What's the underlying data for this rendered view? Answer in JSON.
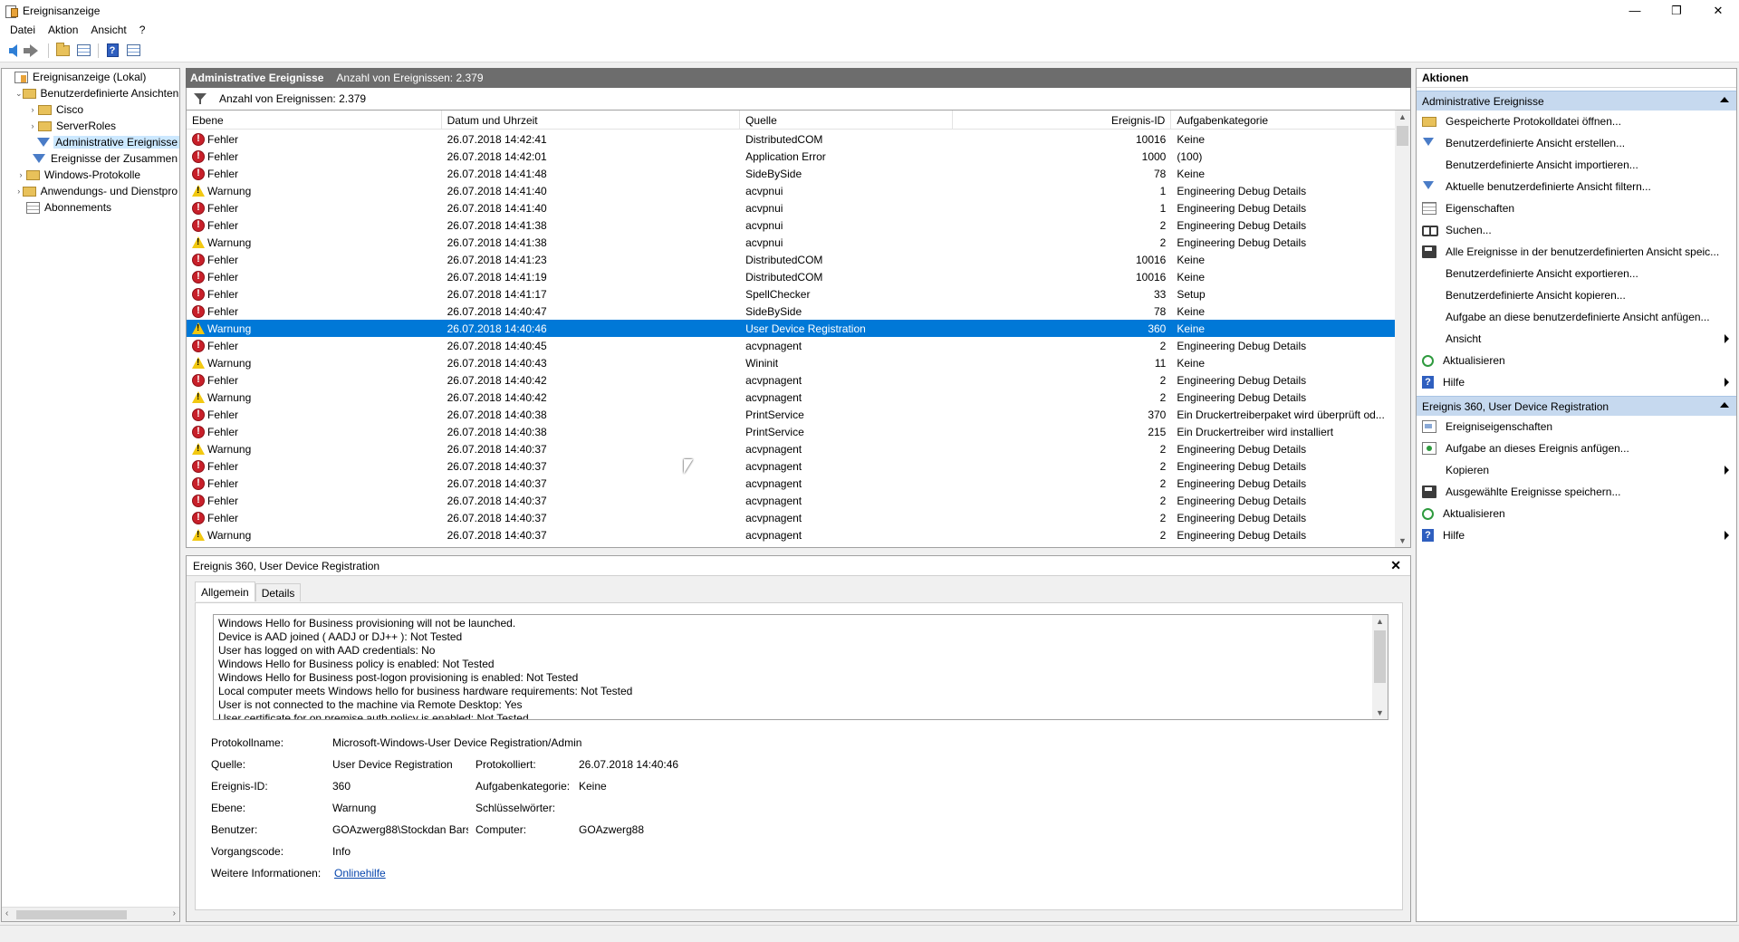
{
  "window": {
    "title": "Ereignisanzeige",
    "minimize": "—",
    "maximize": "❐",
    "close": "✕"
  },
  "menu": [
    "Datei",
    "Aktion",
    "Ansicht",
    "?"
  ],
  "tree": {
    "items": [
      {
        "label": "Ereignisanzeige (Lokal)",
        "indent": 0,
        "twist": "",
        "icon": "log"
      },
      {
        "label": "Benutzerdefinierte Ansichten",
        "indent": 1,
        "twist": "⌄",
        "icon": "folder"
      },
      {
        "label": "Cisco",
        "indent": 2,
        "twist": "›",
        "icon": "folder"
      },
      {
        "label": "ServerRoles",
        "indent": 2,
        "twist": "›",
        "icon": "folder"
      },
      {
        "label": "Administrative Ereignisse",
        "indent": 2,
        "twist": "",
        "icon": "filter",
        "selected": true
      },
      {
        "label": "Ereignisse der Zusammen",
        "indent": 2,
        "twist": "",
        "icon": "filter"
      },
      {
        "label": "Windows-Protokolle",
        "indent": 1,
        "twist": "›",
        "icon": "folder"
      },
      {
        "label": "Anwendungs- und Dienstpro",
        "indent": 1,
        "twist": "›",
        "icon": "folder"
      },
      {
        "label": "Abonnements",
        "indent": 1,
        "twist": "",
        "icon": "sub"
      }
    ]
  },
  "center": {
    "header_title": "Administrative Ereignisse",
    "header_count": "Anzahl von Ereignissen: 2.379",
    "filter_text": "Anzahl von Ereignissen: 2.379"
  },
  "grid": {
    "columns": [
      "Ebene",
      "Datum und Uhrzeit",
      "Quelle",
      "Ereignis-ID",
      "Aufgabenkategorie"
    ],
    "rows": [
      {
        "level": "Fehler",
        "type": "err",
        "date": "26.07.2018 14:42:41",
        "source": "DistributedCOM",
        "id": "10016",
        "task": "Keine"
      },
      {
        "level": "Fehler",
        "type": "err",
        "date": "26.07.2018 14:42:01",
        "source": "Application Error",
        "id": "1000",
        "task": "(100)"
      },
      {
        "level": "Fehler",
        "type": "err",
        "date": "26.07.2018 14:41:48",
        "source": "SideBySide",
        "id": "78",
        "task": "Keine"
      },
      {
        "level": "Warnung",
        "type": "warn",
        "date": "26.07.2018 14:41:40",
        "source": "acvpnui",
        "id": "1",
        "task": "Engineering Debug Details"
      },
      {
        "level": "Fehler",
        "type": "err",
        "date": "26.07.2018 14:41:40",
        "source": "acvpnui",
        "id": "1",
        "task": "Engineering Debug Details"
      },
      {
        "level": "Fehler",
        "type": "err",
        "date": "26.07.2018 14:41:38",
        "source": "acvpnui",
        "id": "2",
        "task": "Engineering Debug Details"
      },
      {
        "level": "Warnung",
        "type": "warn",
        "date": "26.07.2018 14:41:38",
        "source": "acvpnui",
        "id": "2",
        "task": "Engineering Debug Details"
      },
      {
        "level": "Fehler",
        "type": "err",
        "date": "26.07.2018 14:41:23",
        "source": "DistributedCOM",
        "id": "10016",
        "task": "Keine"
      },
      {
        "level": "Fehler",
        "type": "err",
        "date": "26.07.2018 14:41:19",
        "source": "DistributedCOM",
        "id": "10016",
        "task": "Keine"
      },
      {
        "level": "Fehler",
        "type": "err",
        "date": "26.07.2018 14:41:17",
        "source": "SpellChecker",
        "id": "33",
        "task": "Setup"
      },
      {
        "level": "Fehler",
        "type": "err",
        "date": "26.07.2018 14:40:47",
        "source": "SideBySide",
        "id": "78",
        "task": "Keine"
      },
      {
        "level": "Warnung",
        "type": "warn",
        "date": "26.07.2018 14:40:46",
        "source": "User Device Registration",
        "id": "360",
        "task": "Keine",
        "selected": true
      },
      {
        "level": "Fehler",
        "type": "err",
        "date": "26.07.2018 14:40:45",
        "source": "acvpnagent",
        "id": "2",
        "task": "Engineering Debug Details"
      },
      {
        "level": "Warnung",
        "type": "warn",
        "date": "26.07.2018 14:40:43",
        "source": "Wininit",
        "id": "11",
        "task": "Keine"
      },
      {
        "level": "Fehler",
        "type": "err",
        "date": "26.07.2018 14:40:42",
        "source": "acvpnagent",
        "id": "2",
        "task": "Engineering Debug Details"
      },
      {
        "level": "Warnung",
        "type": "warn",
        "date": "26.07.2018 14:40:42",
        "source": "acvpnagent",
        "id": "2",
        "task": "Engineering Debug Details"
      },
      {
        "level": "Fehler",
        "type": "err",
        "date": "26.07.2018 14:40:38",
        "source": "PrintService",
        "id": "370",
        "task": "Ein Druckertreiberpaket wird überprüft od..."
      },
      {
        "level": "Fehler",
        "type": "err",
        "date": "26.07.2018 14:40:38",
        "source": "PrintService",
        "id": "215",
        "task": "Ein Druckertreiber wird installiert"
      },
      {
        "level": "Warnung",
        "type": "warn",
        "date": "26.07.2018 14:40:37",
        "source": "acvpnagent",
        "id": "2",
        "task": "Engineering Debug Details"
      },
      {
        "level": "Fehler",
        "type": "err",
        "date": "26.07.2018 14:40:37",
        "source": "acvpnagent",
        "id": "2",
        "task": "Engineering Debug Details"
      },
      {
        "level": "Fehler",
        "type": "err",
        "date": "26.07.2018 14:40:37",
        "source": "acvpnagent",
        "id": "2",
        "task": "Engineering Debug Details"
      },
      {
        "level": "Fehler",
        "type": "err",
        "date": "26.07.2018 14:40:37",
        "source": "acvpnagent",
        "id": "2",
        "task": "Engineering Debug Details"
      },
      {
        "level": "Fehler",
        "type": "err",
        "date": "26.07.2018 14:40:37",
        "source": "acvpnagent",
        "id": "2",
        "task": "Engineering Debug Details"
      },
      {
        "level": "Warnung",
        "type": "warn",
        "date": "26.07.2018 14:40:37",
        "source": "acvpnagent",
        "id": "2",
        "task": "Engineering Debug Details"
      }
    ]
  },
  "detail": {
    "title": "Ereignis 360, User Device Registration",
    "close": "✕",
    "tabs": [
      "Allgemein",
      "Details"
    ],
    "message_lines": [
      "Windows Hello for Business provisioning will not be launched.",
      "Device is AAD joined ( AADJ or DJ++ ): Not Tested",
      "User has logged on with AAD credentials: No",
      "Windows Hello for Business policy is enabled: Not Tested",
      "Windows Hello for Business post-logon provisioning is enabled: Not Tested",
      "Local computer meets Windows hello for business hardware requirements: Not Tested",
      "User is not connected to the machine via Remote Desktop: Yes",
      "User certificate for on premise auth policy is enabled: Not Tested"
    ],
    "props": {
      "protokollname_label": "Protokollname:",
      "protokollname": "Microsoft-Windows-User Device Registration/Admin",
      "quelle_label": "Quelle:",
      "quelle": "User Device Registration",
      "protokolliert_label": "Protokolliert:",
      "protokolliert": "26.07.2018 14:40:46",
      "id_label": "Ereignis-ID:",
      "id": "360",
      "kategorie_label": "Aufgabenkategorie:",
      "kategorie": "Keine",
      "ebene_label": "Ebene:",
      "ebene": "Warnung",
      "schluessel_label": "Schlüsselwörter:",
      "schluessel": "",
      "benutzer_label": "Benutzer:",
      "benutzer": "GOAzwerg88\\Stockdan Bars",
      "computer_label": "Computer:",
      "computer": "GOAzwerg88",
      "vorgang_label": "Vorgangscode:",
      "vorgang": "Info",
      "weitere_label": "Weitere Informationen:",
      "weitere_link": "Onlinehilfe"
    }
  },
  "actions": {
    "title": "Aktionen",
    "section1": "Administrative Ereignisse",
    "items1": [
      {
        "label": "Gespeicherte Protokolldatei öffnen...",
        "icon": "folder"
      },
      {
        "label": "Benutzerdefinierte Ansicht erstellen...",
        "icon": "filter"
      },
      {
        "label": "Benutzerdefinierte Ansicht importieren...",
        "icon": "none"
      },
      {
        "label": "Aktuelle benutzerdefinierte Ansicht filtern...",
        "icon": "filter"
      },
      {
        "label": "Eigenschaften",
        "icon": "props"
      },
      {
        "label": "Suchen...",
        "icon": "find"
      },
      {
        "label": "Alle Ereignisse in der benutzerdefinierten Ansicht speic...",
        "icon": "save"
      },
      {
        "label": "Benutzerdefinierte Ansicht exportieren...",
        "icon": "none"
      },
      {
        "label": "Benutzerdefinierte Ansicht kopieren...",
        "icon": "none"
      },
      {
        "label": "Aufgabe an diese benutzerdefinierte Ansicht anfügen...",
        "icon": "none"
      },
      {
        "label": "Ansicht",
        "icon": "none",
        "submenu": true
      },
      {
        "label": "Aktualisieren",
        "icon": "refresh"
      },
      {
        "label": "Hilfe",
        "icon": "help",
        "submenu": true
      }
    ],
    "section2": "Ereignis 360, User Device Registration",
    "items2": [
      {
        "label": "Ereigniseigenschaften",
        "icon": "evprops"
      },
      {
        "label": "Aufgabe an dieses Ereignis anfügen...",
        "icon": "task"
      },
      {
        "label": "Kopieren",
        "icon": "none",
        "submenu": true
      },
      {
        "label": "Ausgewählte Ereignisse speichern...",
        "icon": "save"
      },
      {
        "label": "Aktualisieren",
        "icon": "refresh"
      },
      {
        "label": "Hilfe",
        "icon": "help",
        "submenu": true
      }
    ]
  }
}
